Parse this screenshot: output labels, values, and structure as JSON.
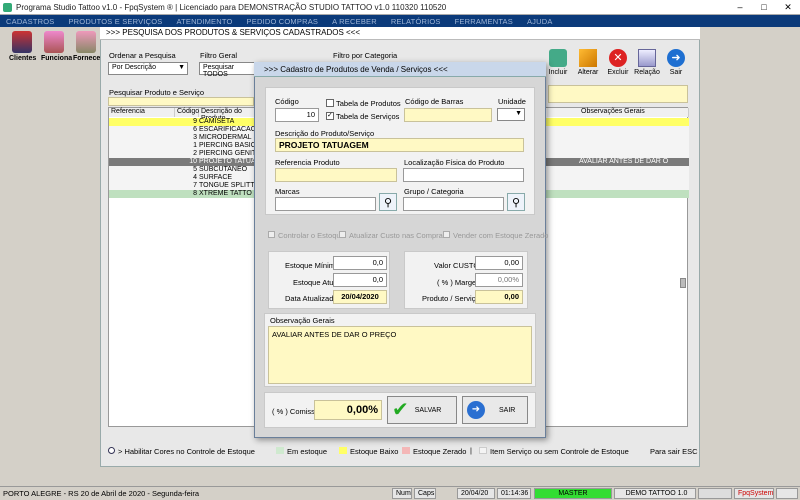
{
  "window": {
    "title": "Programa Studio Tattoo v1.0 - FpqSystem ® | Licenciado para  DEMONSTRAÇÃO STUDIO TATTOO v1.0 110320 110520"
  },
  "menu": [
    "CADASTROS",
    "PRODUTOS E SERVIÇOS",
    "ATENDIMENTO",
    "PEDIDO COMPRAS",
    "A RECEBER",
    "RELATÓRIOS",
    "FERRAMENTAS",
    "AJUDA"
  ],
  "left_toolbar": [
    {
      "label": "Clientes",
      "icon": "clients-icon"
    },
    {
      "label": "Funciona",
      "icon": "employees-icon"
    },
    {
      "label": "Fornece",
      "icon": "suppliers-icon"
    }
  ],
  "search_window": {
    "title": ">>>  PESQUISA DOS PRODUTOS & SERVIÇOS CADASTRADOS  <<<",
    "ordenar_label": "Ordenar a Pesquisa",
    "ordenar_value": "Por Descrição",
    "filtro_geral_label": "Filtro Geral",
    "filtro_geral_value": "Pesquisar TODOS",
    "filtro_categoria_label": "Filtro por Categoria",
    "pesquisar_label": "Pesquisar Produto e Serviço",
    "columns": [
      "Referencia",
      "Código",
      "Descrição do Produto",
      "Observações Gerais"
    ],
    "rows": [
      {
        "codigo": "9",
        "descricao": "CAMISETA",
        "obs": ""
      },
      {
        "codigo": "6",
        "descricao": "ESCARIFICACAO",
        "obs": ""
      },
      {
        "codigo": "3",
        "descricao": "MICRODERMAL",
        "obs": ""
      },
      {
        "codigo": "1",
        "descricao": "PIERCING BASICO",
        "obs": ""
      },
      {
        "codigo": "2",
        "descricao": "PIERCING GENITAL",
        "obs": ""
      },
      {
        "codigo": "10",
        "descricao": "PROJETO TATUAG",
        "obs": "AVALIAR ANTES DE DAR O PREÇ"
      },
      {
        "codigo": "5",
        "descricao": "SUBCUTANEO",
        "obs": ""
      },
      {
        "codigo": "4",
        "descricao": "SURFACE",
        "obs": ""
      },
      {
        "codigo": "7",
        "descricao": "TONGUE SPLITTIN",
        "obs": ""
      },
      {
        "codigo": "8",
        "descricao": "XTREME TATTO",
        "obs": ""
      }
    ]
  },
  "right_toolbar": [
    {
      "label": "Incluir",
      "icon": "add-icon"
    },
    {
      "label": "Alterar",
      "icon": "edit-icon"
    },
    {
      "label": "Excluir",
      "icon": "delete-icon"
    },
    {
      "label": "Relação",
      "icon": "report-icon"
    },
    {
      "label": "Sair",
      "icon": "exit-icon"
    }
  ],
  "modal": {
    "title": ">>>  Cadastro de Produtos de Venda / Serviços  <<<",
    "codigo_label": "Código",
    "codigo_value": "10",
    "tabela_produtos": "Tabela de Produtos",
    "tabela_servicos": "Tabela de Serviços",
    "codigo_barras_label": "Código de Barras",
    "unidade_label": "Unidade",
    "descricao_label": "Descrição do Produto/Serviço",
    "descricao_value": "PROJETO TATUAGEM",
    "referencia_label": "Referencia Produto",
    "localizacao_label": "Localização Física do Produto",
    "marcas_label": "Marcas",
    "grupo_label": "Grupo / Categoria",
    "controlar_estoque": "Controlar o Estoque",
    "atualizar_custo": "Atualizar Custo nas Compras",
    "vender_sem_estoque": "Vender com Estoque Zerado",
    "estoque_minimo_label": "Estoque Mínimo",
    "estoque_minimo_value": "0,0",
    "estoque_atual_label": "Estoque Atual",
    "estoque_atual_value": "0,0",
    "data_atualizado_label": "Data Atualizado",
    "data_atualizado_value": "20/04/2020",
    "valor_custo_label": "Valor CUSTO",
    "valor_custo_value": "0,00",
    "margem_label": "( % ) Margem",
    "margem_value": "0,00%",
    "produto_servico_label": "Produto / Serviço",
    "produto_servico_value": "0,00",
    "observacao_label": "Observação Gerais",
    "observacao_value": "AVALIAR ANTES DE DAR O PREÇO",
    "comissao_label": "( % ) Comissão",
    "comissao_value": "0,00%",
    "salvar_label": "SALVAR",
    "sair_label": "SAIR"
  },
  "legend": {
    "habilitar": "> Habilitar Cores no Controle de Estoque",
    "em_estoque": "Em estoque",
    "estoque_baixo": "Estoque Baixo",
    "estoque_zerado": "Estoque Zerado",
    "item_servico": "Item Serviço ou sem Controle de Estoque",
    "para_sair": "Para sair ESC",
    "colors": {
      "em_estoque": "#cfe9cf",
      "estoque_baixo": "#ffff66",
      "estoque_zerado": "#f4b7b7"
    }
  },
  "status": {
    "location": "PORTO ALEGRE - RS 20 de Abril de 2020 - Segunda-feira",
    "num": "Num",
    "caps": "Caps",
    "date": "20/04/20",
    "time": "01:14:36",
    "master": "MASTER",
    "company": "DEMO TATTOO 1.0",
    "brand": "FpqSystem"
  }
}
